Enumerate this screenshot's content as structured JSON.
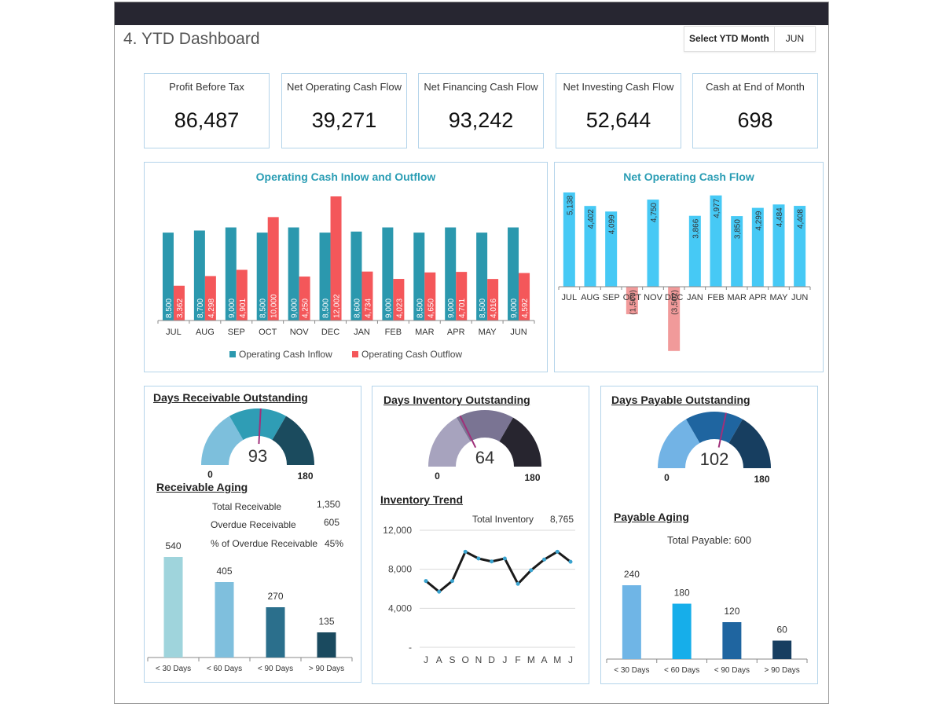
{
  "header": {
    "title": "4. YTD Dashboard",
    "month_select_label": "Select YTD Month",
    "month_select_value": "JUN"
  },
  "kpis": [
    {
      "label": "Profit Before Tax",
      "value": "86,487"
    },
    {
      "label": "Net Operating Cash Flow",
      "value": "39,271"
    },
    {
      "label": "Net Financing Cash Flow",
      "value": "93,242"
    },
    {
      "label": "Net Investing Cash Flow",
      "value": "52,644"
    },
    {
      "label": "Cash at End of Month",
      "value": "698"
    }
  ],
  "colors": {
    "inflow": "#2b98ae",
    "outflow": "#f4575a",
    "net_positive": "#46c9f5",
    "net_negative": "#f19a9a",
    "title_accent": "#2a9db4"
  },
  "chart_data": [
    {
      "id": "operating-cash",
      "type": "bar",
      "title": "Operating Cash Inlow and Outflow",
      "categories": [
        "JUL",
        "AUG",
        "SEP",
        "OCT",
        "NOV",
        "DEC",
        "JAN",
        "FEB",
        "MAR",
        "APR",
        "MAY",
        "JUN"
      ],
      "series": [
        {
          "name": "Operating Cash Inflow",
          "values": [
            8500,
            8700,
            9000,
            8500,
            9000,
            8500,
            8600,
            9000,
            8500,
            9000,
            8500,
            9000
          ],
          "labels": [
            "8,500",
            "8,700",
            "9,000",
            "8,500",
            "9,000",
            "8,500",
            "8,600",
            "9,000",
            "8,500",
            "9,000",
            "8,500",
            "9,000"
          ]
        },
        {
          "name": "Operating Cash Outflow",
          "values": [
            3362,
            4298,
            4901,
            10000,
            4250,
            12002,
            4734,
            4023,
            4650,
            4701,
            4016,
            4592
          ],
          "labels": [
            "3,362",
            "4,298",
            "4,901",
            "10,000",
            "4,250",
            "12,002",
            "4,734",
            "4,023",
            "4,650",
            "4,701",
            "4,016",
            "4,592"
          ]
        }
      ],
      "ylim": [
        0,
        12002
      ],
      "legend": "bottom"
    },
    {
      "id": "net-operating",
      "type": "bar",
      "title": "Net Operating Cash Flow",
      "categories": [
        "JUL",
        "AUG",
        "SEP",
        "OCT",
        "NOV",
        "DEC",
        "JAN",
        "FEB",
        "MAR",
        "APR",
        "MAY",
        "JUN"
      ],
      "values": [
        5138,
        4402,
        4099,
        -1500,
        4750,
        -3502,
        3866,
        4977,
        3850,
        4299,
        4484,
        4408
      ],
      "labels": [
        "5,138",
        "4,402",
        "4,099",
        "(1,500)",
        "4,750",
        "(3,502)",
        "3,866",
        "4,977",
        "3,850",
        "4,299",
        "4,484",
        "4,408"
      ],
      "ylim": [
        -3502,
        5138
      ]
    },
    {
      "id": "dro-gauge",
      "type": "pie",
      "title": "Days Receivable Outstanding",
      "value": 93,
      "min": 0,
      "max": 180,
      "min_label": "0",
      "max_label": "180",
      "segments": [
        {
          "to": 60,
          "color": "#7dbfdc"
        },
        {
          "to": 120,
          "color": "#2f9db5"
        },
        {
          "to": 180,
          "color": "#1b4b5e"
        }
      ]
    },
    {
      "id": "receivable-aging",
      "type": "bar",
      "title": "Receivable Aging",
      "categories": [
        "< 30 Days",
        "< 60 Days",
        "< 90 Days",
        "> 90 Days"
      ],
      "values": [
        540,
        405,
        270,
        135
      ],
      "colors": [
        "#9fd4dc",
        "#7fbfdd",
        "#2b6f8c",
        "#1a4a5f"
      ],
      "ylim": [
        0,
        540
      ]
    },
    {
      "id": "dio-gauge",
      "type": "pie",
      "title": "Days Inventory Outstanding",
      "value": 64,
      "min": 0,
      "max": 180,
      "min_label": "0",
      "max_label": "180",
      "segments": [
        {
          "to": 60,
          "color": "#a7a3be"
        },
        {
          "to": 120,
          "color": "#7a7493"
        },
        {
          "to": 180,
          "color": "#27252f"
        }
      ]
    },
    {
      "id": "inventory-trend",
      "type": "line",
      "title": "Inventory Trend",
      "x": [
        "J",
        "A",
        "S",
        "O",
        "N",
        "D",
        "J",
        "F",
        "M",
        "A",
        "M",
        "J"
      ],
      "values": [
        6800,
        5700,
        6800,
        9800,
        9100,
        8800,
        9100,
        6500,
        7900,
        9000,
        9800,
        8765
      ],
      "ylim": [
        0,
        12000
      ],
      "yticks": [
        0,
        4000,
        8000,
        12000
      ],
      "ytick_labels": [
        "-",
        "4,000",
        "8,000",
        "12,000"
      ],
      "grid": true
    },
    {
      "id": "dpo-gauge",
      "type": "pie",
      "title": "Days Payable Outstanding",
      "value": 102,
      "min": 0,
      "max": 180,
      "min_label": "0",
      "max_label": "180",
      "segments": [
        {
          "to": 60,
          "color": "#72b3e5"
        },
        {
          "to": 120,
          "color": "#1f65a0"
        },
        {
          "to": 180,
          "color": "#173e60"
        }
      ]
    },
    {
      "id": "payable-aging",
      "type": "bar",
      "title": "Payable Aging",
      "categories": [
        "< 30 Days",
        "< 60 Days",
        "< 90 Days",
        "> 90 Days"
      ],
      "values": [
        240,
        180,
        120,
        60
      ],
      "colors": [
        "#6fb5e6",
        "#16aeea",
        "#1f65a0",
        "#173e60"
      ],
      "ylim": [
        0,
        240
      ]
    }
  ],
  "receivable_stats": [
    {
      "label": "Total Receivable",
      "value": "1,350"
    },
    {
      "label": "Overdue Receivable",
      "value": "605"
    },
    {
      "label": "% of Overdue Receivable",
      "value": "45%"
    }
  ],
  "inventory_stats": {
    "label": "Total Inventory",
    "value": "8,765"
  },
  "payable_stats": {
    "label": "Total Payable: 600"
  }
}
